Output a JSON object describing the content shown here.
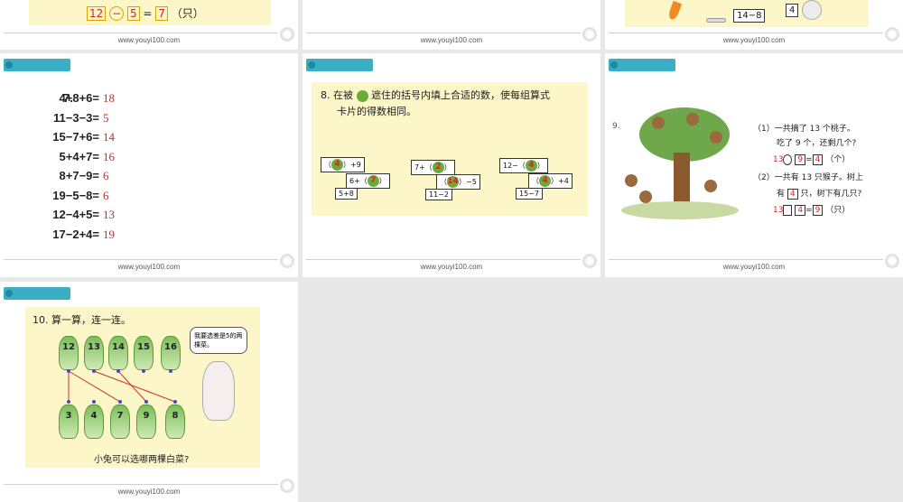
{
  "footer": "www.youyi100.com",
  "top_left": {
    "a": "12",
    "op": "−",
    "b": "5",
    "eq": "=",
    "r": "7",
    "unit": "（只）"
  },
  "top_right": {
    "expr": "14−8",
    "ans": "4"
  },
  "q7": {
    "num": "7.",
    "rows": [
      {
        "lhs": "4+8+6=",
        "ans": "18"
      },
      {
        "lhs": "11−3−3=",
        "ans": "5"
      },
      {
        "lhs": "15−7+6=",
        "ans": "14"
      },
      {
        "lhs": "5+4+7=",
        "ans": "16"
      },
      {
        "lhs": "8+7−9=",
        "ans": "6"
      },
      {
        "lhs": "19−5−8=",
        "ans": "6"
      },
      {
        "lhs": "12−4+5=",
        "ans": "13"
      },
      {
        "lhs": "17−2+4=",
        "ans": "19"
      }
    ]
  },
  "q8": {
    "title_1": "8. 在被",
    "title_2": "遮住的括号内填上合适的数，使每组算式",
    "title_3": "卡片的得数相同。",
    "g1": {
      "c1a": "（",
      "c1n": "4",
      "c1b": "）+9",
      "c2a": "6+（",
      "c2n": "7",
      "c2b": "）",
      "c3": "5+8"
    },
    "g2": {
      "c1a": "7+（",
      "c1n": "2",
      "c1b": "）",
      "c2a": "（",
      "c2n": "14",
      "c2b": "）−5",
      "c3": "11−2"
    },
    "g3": {
      "c1a": "12−（",
      "c1n": "4",
      "c1b": "）",
      "c2a": "（",
      "c2n": "4",
      "c2b": "）+4",
      "c3": "15−7"
    }
  },
  "q9": {
    "num": "9.",
    "p1_l1": "（1）一共摘了 13 个桃子。",
    "p1_l2": "吃了 9 个，还剩几个?",
    "p1_a": "13",
    "p1_b": "9",
    "p1_c": "4",
    "p1_unit": "（个）",
    "p2_l1": "（2）一共有 13 只猴子。树上",
    "p2_l2a": "有",
    "p2_l2n": "4",
    "p2_l2b": "只，树下有几只?",
    "p2_a": "13",
    "p2_b": "4",
    "p2_c": "9",
    "p2_unit": "（只）"
  },
  "q10": {
    "title": "10. 算一算，连一连。",
    "bubble": "我要选差是5的两棵菜。",
    "top": [
      "12",
      "13",
      "14",
      "15",
      "16"
    ],
    "bottom": [
      "3",
      "4",
      "7",
      "9",
      "8"
    ],
    "question": "小兔可以选哪两棵白菜?"
  },
  "colors": {
    "tab": "#3aaec4",
    "yellow_bg": "#fdf6c8",
    "answer": "#d22222"
  }
}
